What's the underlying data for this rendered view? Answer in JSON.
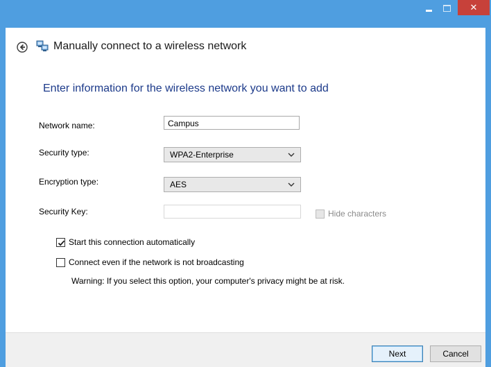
{
  "window": {
    "header_title": "Manually connect to a wireless network",
    "caption": {
      "minimize_glyph": "–",
      "close_glyph": "✕"
    }
  },
  "instruction": "Enter information for the wireless network you want to add",
  "fields": {
    "network_name": {
      "label": "Network name:",
      "value": "Campus"
    },
    "security_type": {
      "label": "Security type:",
      "value": "WPA2-Enterprise"
    },
    "encryption_type": {
      "label": "Encryption type:",
      "value": "AES"
    },
    "security_key": {
      "label": "Security Key:",
      "value": ""
    }
  },
  "options": {
    "hide_characters": {
      "label": "Hide characters",
      "checked": false,
      "enabled": false
    },
    "start_auto": {
      "label": "Start this connection automatically",
      "checked": true
    },
    "connect_not_broadcasting": {
      "label": "Connect even if the network is not broadcasting",
      "checked": false
    }
  },
  "warning": "Warning: If you select this option, your computer's privacy might be at risk.",
  "buttons": {
    "next": "Next",
    "cancel": "Cancel"
  },
  "colors": {
    "title_bar": "#4f9ee0",
    "close_button": "#c7413a",
    "instruction_text": "#1c3a8a"
  },
  "icons": {
    "back": "back-arrow-icon",
    "network": "network-icon",
    "dropdown": "chevron-down-icon",
    "check": "checkmark-icon"
  }
}
